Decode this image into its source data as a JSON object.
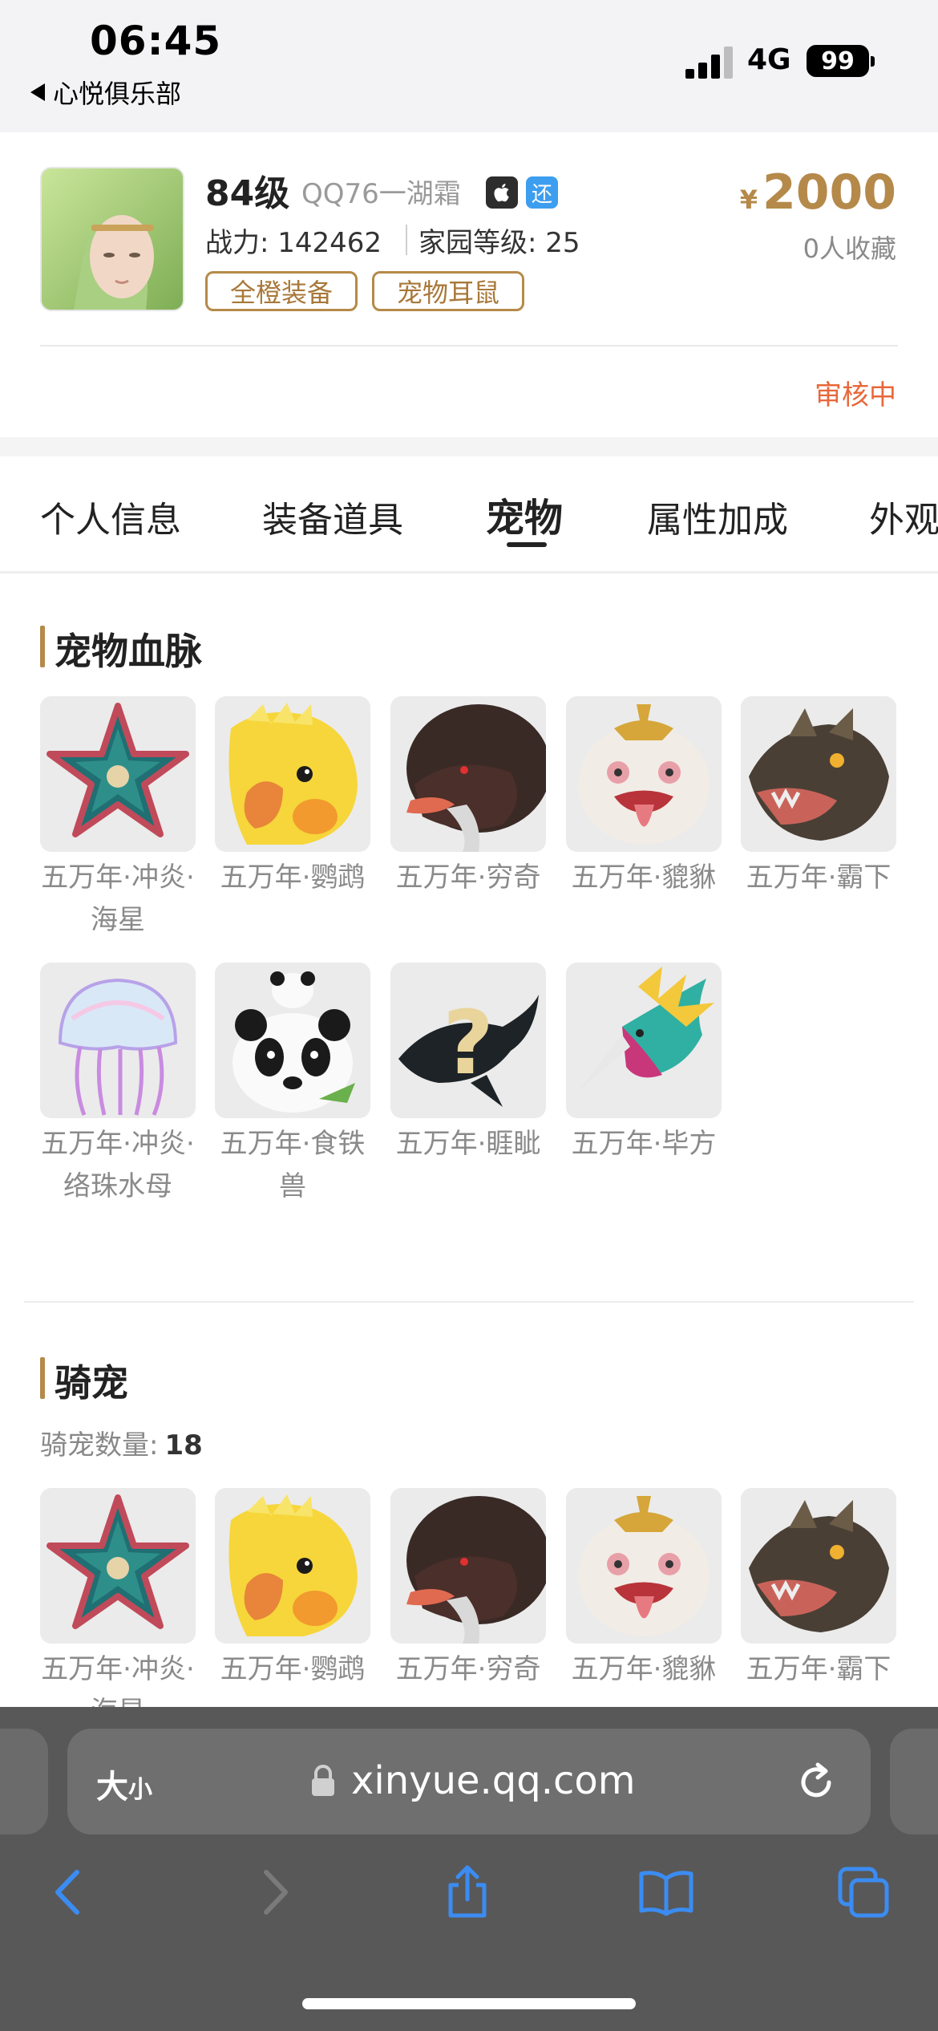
{
  "status_bar": {
    "time": "06:45",
    "back_app": "心悦俱乐部",
    "network": "4G",
    "battery": "99"
  },
  "listing": {
    "level": "84级",
    "server": "QQ76一湖霜",
    "platform_icon": "apple-icon",
    "badge": "还",
    "power": "战力: 142462",
    "home_level": "家园等级: 25",
    "tags": [
      "全橙装备",
      "宠物耳鼠"
    ],
    "price_symbol": "¥",
    "price": "2000",
    "collect": "0人收藏",
    "status": "审核中"
  },
  "tabs": [
    {
      "label": "个人信息",
      "active": false
    },
    {
      "label": "装备道具",
      "active": false
    },
    {
      "label": "宠物",
      "active": true
    },
    {
      "label": "属性加成",
      "active": false
    },
    {
      "label": "外观",
      "active": false
    }
  ],
  "pet_bloodline": {
    "title": "宠物血脉",
    "items": [
      {
        "name": "五万年·冲炎·海星",
        "icon": "starfish-icon"
      },
      {
        "name": "五万年·鹦鹉",
        "icon": "parrot-icon"
      },
      {
        "name": "五万年·穷奇",
        "icon": "qiongqi-icon"
      },
      {
        "name": "五万年·貔貅",
        "icon": "pixiu-icon"
      },
      {
        "name": "五万年·霸下",
        "icon": "baxia-icon"
      },
      {
        "name": "五万年·冲炎·络珠水母",
        "icon": "jellyfish-icon"
      },
      {
        "name": "五万年·食铁兽",
        "icon": "panda-icon"
      },
      {
        "name": "五万年·睚眦",
        "icon": "yazi-icon"
      },
      {
        "name": "五万年·毕方",
        "icon": "bifang-icon"
      }
    ]
  },
  "mounts": {
    "title": "骑宠",
    "count_label": "骑宠数量:",
    "count": "18",
    "items": [
      {
        "name": "五万年·冲炎·海星",
        "icon": "starfish-icon"
      },
      {
        "name": "五万年·鹦鹉",
        "icon": "parrot-icon"
      },
      {
        "name": "五万年·穷奇",
        "icon": "qiongqi-icon"
      },
      {
        "name": "五万年·貔貅",
        "icon": "pixiu-icon"
      },
      {
        "name": "五万年·霸下",
        "icon": "baxia-icon"
      }
    ]
  },
  "browser": {
    "text_size": "大",
    "text_size_small": "小",
    "url": "xinyue.qq.com"
  },
  "colors": {
    "accent_gold": "#b58a4a",
    "status_orange": "#e8683a",
    "ios_blue": "#3b8cf2"
  }
}
